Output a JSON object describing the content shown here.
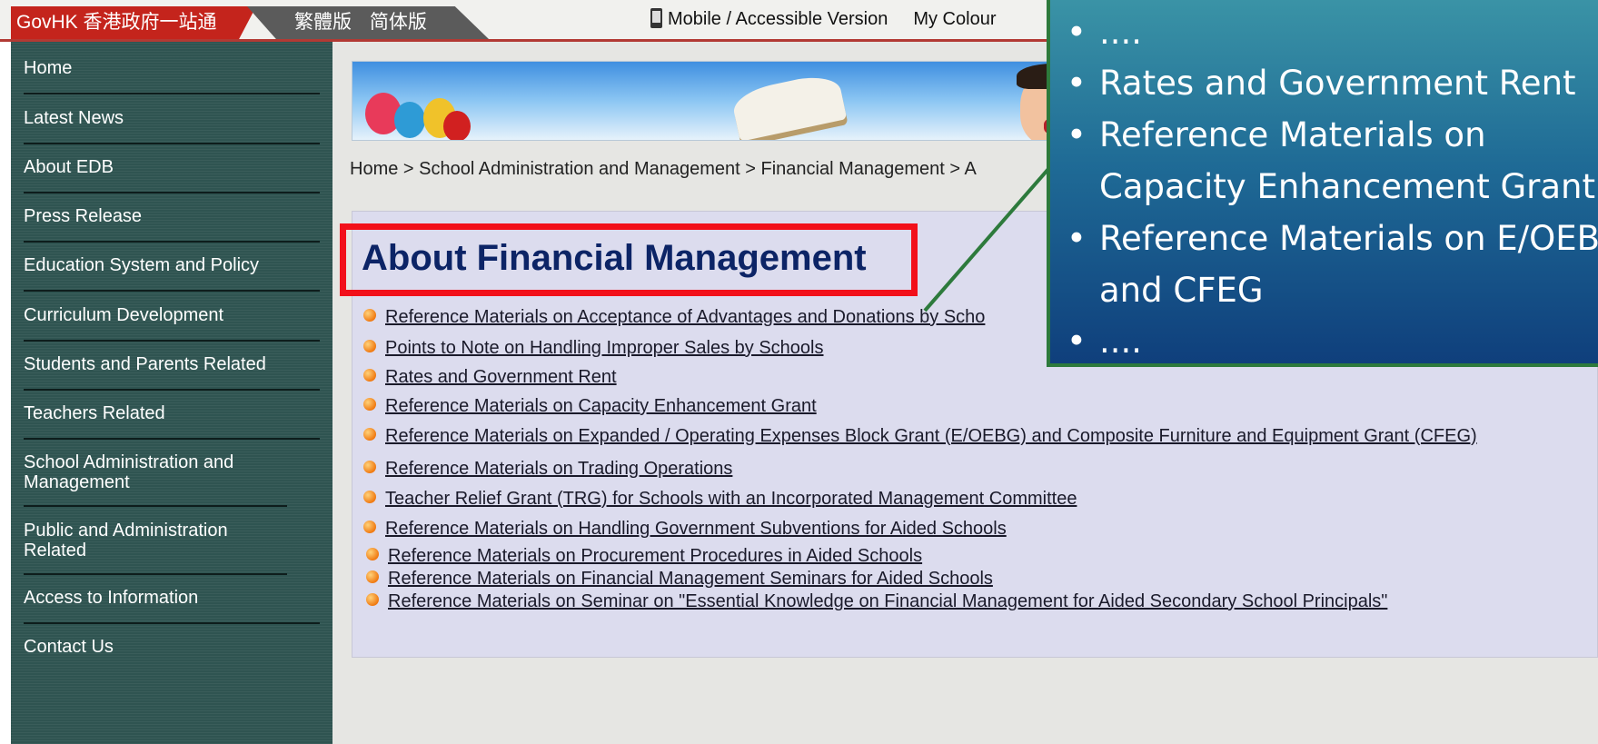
{
  "topbar": {
    "govhk_logo": "GovHK 香港政府一站通",
    "lang_traditional": "繁體版",
    "lang_simplified": "简体版",
    "mobile_link": "Mobile / Accessible Version",
    "my_colour_link": "My Colour",
    "phone_icon": "mobile-phone-icon"
  },
  "sidebar": {
    "items": [
      {
        "label": "Home"
      },
      {
        "label": "Latest News"
      },
      {
        "label": "About EDB"
      },
      {
        "label": "Press Release"
      },
      {
        "label": "Education System and Policy"
      },
      {
        "label": "Curriculum Development"
      },
      {
        "label": "Students and Parents Related"
      },
      {
        "label": "Teachers Related"
      },
      {
        "label": "School Administration and Management"
      },
      {
        "label": "Public and Administration Related"
      },
      {
        "label": "Access to Information"
      },
      {
        "label": "Contact Us"
      }
    ]
  },
  "main": {
    "breadcrumb": "Home > School Administration and Management > Financial Management > A",
    "page_title": "About Financial Management",
    "links": [
      {
        "label": "Reference Materials on Acceptance of Advantages and Donations by Scho"
      },
      {
        "label": "Points to Note on Handling Improper Sales by Schools"
      },
      {
        "label": "Rates and Government Rent"
      },
      {
        "label": "Reference Materials on Capacity Enhancement Grant"
      },
      {
        "label": "Reference Materials on Expanded / Operating Expenses Block Grant (E/OEBG) and Composite Furniture and Equipment Grant (CFEG)"
      },
      {
        "label": "Reference Materials on Trading Operations"
      },
      {
        "label": "Teacher Relief Grant (TRG) for Schools with an Incorporated Management Committee"
      },
      {
        "label": "Reference Materials on Handling Government Subventions for Aided Schools"
      },
      {
        "label": "Reference Materials on Procurement Procedures in Aided Schools"
      },
      {
        "label": "Reference Materials on Financial Management Seminars for Aided Schools"
      },
      {
        "label": "Reference Materials on Seminar on \"Essential Knowledge on Financial Management for Aided Secondary School Principals\""
      }
    ]
  },
  "callout": {
    "items": [
      {
        "text": "...."
      },
      {
        "text": "Rates and Government Rent"
      },
      {
        "text": "Reference Materials on Capacity Enhancement Grant"
      },
      {
        "text": "Reference Materials on E/OEBG and CFEG"
      },
      {
        "text": "...."
      }
    ]
  },
  "colors": {
    "highlight_box": "#f2101a",
    "title_text": "#0c2466",
    "sidebar_bg": "#2f5451",
    "callout_border": "#2d7a3c"
  }
}
